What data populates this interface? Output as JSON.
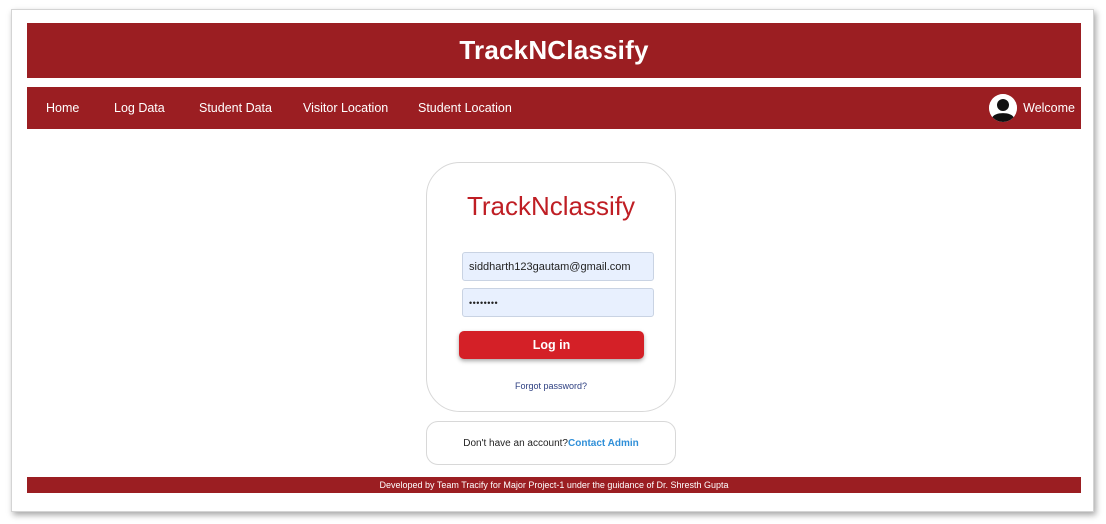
{
  "header": {
    "title": "TrackNClassify"
  },
  "nav": {
    "items": [
      {
        "label": "Home"
      },
      {
        "label": "Log Data"
      },
      {
        "label": "Student Data"
      },
      {
        "label": "Visitor Location"
      },
      {
        "label": "Student Location"
      }
    ],
    "welcome": "Welcome",
    "avatar_icon": "user-avatar-icon"
  },
  "login": {
    "title": "TrackNclassify",
    "email_value": "siddharth123gautam@gmail.com",
    "password_masked": "••••••••",
    "login_button": "Log in",
    "forgot_link": "Forgot password?"
  },
  "signup": {
    "prompt": "Don't have an account?",
    "link": "Contact Admin"
  },
  "footer": {
    "text": "Developed by Team Tracify for Major Project-1 under the guidance of Dr. Shresth Gupta"
  },
  "colors": {
    "brand": "#9b1e22",
    "button": "#d42027",
    "title_red": "#bf1e24",
    "link_blue": "#2f8fd8"
  }
}
